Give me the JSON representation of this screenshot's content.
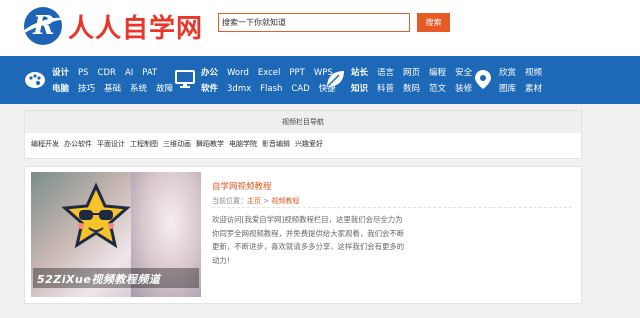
{
  "header": {
    "logo_text": "人人自学网",
    "search_text": "搜索一下你就知道",
    "search_button": "搜索"
  },
  "nav": {
    "groups": [
      {
        "icon": "brush-icon",
        "rows": [
          [
            "设计",
            "PS",
            "CDR",
            "AI",
            "PAT"
          ],
          [
            "电脑",
            "技巧",
            "基础",
            "系统",
            "故障"
          ]
        ]
      },
      {
        "icon": "monitor-icon",
        "rows": [
          [
            "办公",
            "Word",
            "Excel",
            "PPT",
            "WPS"
          ],
          [
            "软件",
            "3dmx",
            "Flash",
            "CAD",
            "快捷"
          ]
        ]
      },
      {
        "icon": "leaf-icon",
        "rows": [
          [
            "站长",
            "语言",
            "网页",
            "编程",
            "安全"
          ],
          [
            "知识",
            "科普",
            "数码",
            "范文",
            "装修"
          ]
        ]
      },
      {
        "icon": "location-pin-icon",
        "rows": [
          [
            "欣赏",
            "视频"
          ],
          [
            "图库",
            "素材"
          ]
        ]
      }
    ]
  },
  "colnav": {
    "title": "视频栏目导航",
    "links": [
      "编程开发",
      "办公软件",
      "平面设计",
      "工程制图",
      "三维动画",
      "舞蹈教学",
      "电脑学院",
      "影音编辑",
      "兴趣爱好"
    ]
  },
  "card": {
    "banner_caption": "52ZiXue视频教程频道",
    "title": "自学网视频教程",
    "crumb_label": "当前位置：",
    "crumb_home": "主页",
    "crumb_sep": " > ",
    "crumb_current": "视频教程",
    "desc": "欢迎访问[我爱自学网]视频教程栏目，这里我们会尽全力为你同罗全网视频教程，并免费提供给大家观看，我们会不断更新，不断进步，喜欢就请多多分享，这样我们会有更多的动力！"
  },
  "colors": {
    "brand_blue": "#1d68b7",
    "accent_orange": "#e65a25",
    "logo_red": "#e8372a"
  }
}
